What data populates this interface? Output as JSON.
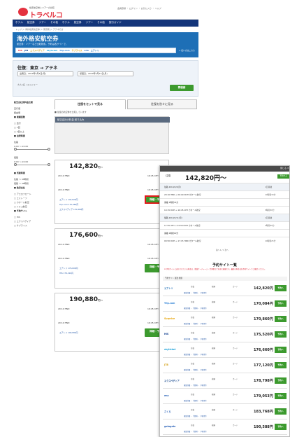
{
  "header": {
    "logo_sub": "格安航空券とツアーの比較",
    "logo_text": "トラベルコ",
    "top_links": "会員登録 ・ ログイン ・ お気に入り ・ ヘルプ"
  },
  "nav": {
    "items": [
      "ホテル",
      "航空券",
      "ツアー",
      "その他",
      "ホテル",
      "航空券",
      "ツアー",
      "その他",
      "旅行ガイド"
    ]
  },
  "breadcrumb": "トップ ＞ 海外格安航空券 ＞ 東京発 ＞ アテネ行き",
  "hero": {
    "title": "海外格安航空券",
    "sub": "航空券・ツアーなど比較検索。予約は各サイトで。",
    "airlines": [
      "HIS",
      "JTB",
      "エクスペディア",
      "skyticket",
      "Trip.com",
      "サプライス",
      "ena",
      "エアトリ"
    ],
    "link": "→ 使い方はこちら"
  },
  "search": {
    "route": "往復：東京 → アテネ",
    "depart": "出発日：2019年2月4日(月)",
    "return": "帰国日：2019年2月11日(月)",
    "pax": "大人1名 / エコノミー",
    "button": "再検索"
  },
  "sidebar": {
    "lines": [
      {
        "text": "航空会社別料金比較",
        "head": true
      },
      {
        "text": "直行便",
        "head": false
      },
      {
        "text": "経由便",
        "head": false
      },
      {
        "text": "■ 乗継回数",
        "head": true
      },
      {
        "text": "□ 直行",
        "head": false
      },
      {
        "text": "□ 1回",
        "head": false
      },
      {
        "text": "□ 2回以上",
        "head": false
      },
      {
        "text": "■ 出発時間",
        "head": true
      },
      {
        "text": "往路",
        "head": false
      },
      {
        "text": "0:00 〜 24:00",
        "head": false
      },
      {
        "text": "復路",
        "head": false
      },
      {
        "text": "0:00 〜 24:00",
        "head": false
      },
      {
        "text": "■ 所要時間",
        "head": true
      },
      {
        "text": "往路 〜 48時間",
        "head": false
      },
      {
        "text": "復路 〜 48時間",
        "head": false
      },
      {
        "text": "■ 航空会社",
        "head": true
      },
      {
        "text": "□ アエロフロート",
        "head": false
      },
      {
        "text": "□ エミレーツ",
        "head": false
      },
      {
        "text": "□ カタール航空",
        "head": false
      },
      {
        "text": "□ トルコ航空",
        "head": false
      },
      {
        "text": "■ 予約サイト",
        "head": true
      },
      {
        "text": "□ HIS",
        "head": false
      },
      {
        "text": "□ エクスペディア",
        "head": false
      },
      {
        "text": "□ サプライス",
        "head": false
      }
    ]
  },
  "tabs": {
    "left": "往復をセットで見る",
    "right": "往復を別々に見る"
  },
  "results": {
    "note": "■ 往復の航空券を比較しています",
    "cond_head": "航空会社の料金 絞り込み",
    "cards": [
      {
        "price": "142,820",
        "suffix": "円〜",
        "dep": "20:10 HND",
        "arr": "16:45 ATH",
        "button": "詳細・予約",
        "sites": [
          "エアトリ 142,820円",
          "Trip.com 170,084円",
          "エクスペディア 170,860円"
        ]
      },
      {
        "price": "176,600",
        "suffix": "円〜",
        "dep": "20:10 HND",
        "arr": "16:45 ATH",
        "button": "詳細・予約",
        "sites": [
          "エアトリ 176,600円",
          "HIS 179,210円"
        ]
      },
      {
        "price": "190,880",
        "suffix": "円〜",
        "dep": "20:10 HND",
        "arr": "16:45 ATH",
        "button": "詳細・予約",
        "sites": [
          "エアトリ 190,880円"
        ]
      }
    ]
  },
  "detail": {
    "close": "閉じる ✕",
    "route": "往復",
    "price": "142,820円〜",
    "flag": "予約する",
    "flights": [
      {
        "t": "往路 2019/2/4(月)",
        "r": "1回乗継",
        "alt": true
      },
      {
        "t": "20:10 HND → 06:40 DOH カタール航空",
        "r": "10時間30分",
        "alt": false
      },
      {
        "t": "乗継 3時間35分",
        "r": "",
        "alt": false
      },
      {
        "t": "10:15 DOH → 16:45 ATH カタール航空",
        "r": "5時間30分",
        "alt": false
      },
      {
        "t": "復路 2019/2/11(月)",
        "r": "1回乗継",
        "alt": true
      },
      {
        "t": "17:55 ATH → 22:50 DOH カタール航空",
        "r": "4時間55分",
        "alt": false
      },
      {
        "t": "乗継 2時間00分",
        "r": "",
        "alt": false
      },
      {
        "t": "00:50 DOH → 17:15 HND カタール航空",
        "r": "10時間25分",
        "alt": false
      }
    ],
    "pager": "前へ  1 / 1  次へ",
    "site_title": "予約サイト一覧",
    "note": "※ 予約サイトに表示されている料金は、燃油サーチャージ・空港税などを含む総額です。最新の料金は各予約サイトでご確認ください。",
    "site_header": "予約サイト   運賃   総額",
    "sites": [
      {
        "name": "エアトリ",
        "color": "#1e6fb6",
        "price": "142,820円",
        "btn": "予約へ"
      },
      {
        "name": "Trip.com",
        "color": "#2a7fd4",
        "price": "170,084円",
        "btn": "予約へ"
      },
      {
        "name": "Surprice",
        "color": "#e6a100",
        "price": "170,860円",
        "btn": "予約へ"
      },
      {
        "name": "HIS",
        "color": "#0b3a8c",
        "price": "175,520円",
        "btn": "予約へ"
      },
      {
        "name": "skyticket",
        "color": "#1aa0d8",
        "price": "176,660円",
        "btn": "予約へ"
      },
      {
        "name": "JTB",
        "color": "#d4a017",
        "price": "177,120円",
        "btn": "予約へ"
      },
      {
        "name": "エクスペディア",
        "color": "#14468c",
        "price": "178,798円",
        "btn": "予約へ"
      },
      {
        "name": "ena",
        "color": "#2a62b8",
        "price": "179,053円",
        "btn": "予約へ"
      },
      {
        "name": "さくら",
        "color": "#2a62b8",
        "price": "183,768円",
        "btn": "予約へ"
      },
      {
        "name": "gotogate",
        "color": "#2a62b8",
        "price": "190,588円",
        "btn": "予約へ"
      }
    ],
    "site_sub": "運賃詳細 ・ 手数料 ・ 予約条件"
  }
}
